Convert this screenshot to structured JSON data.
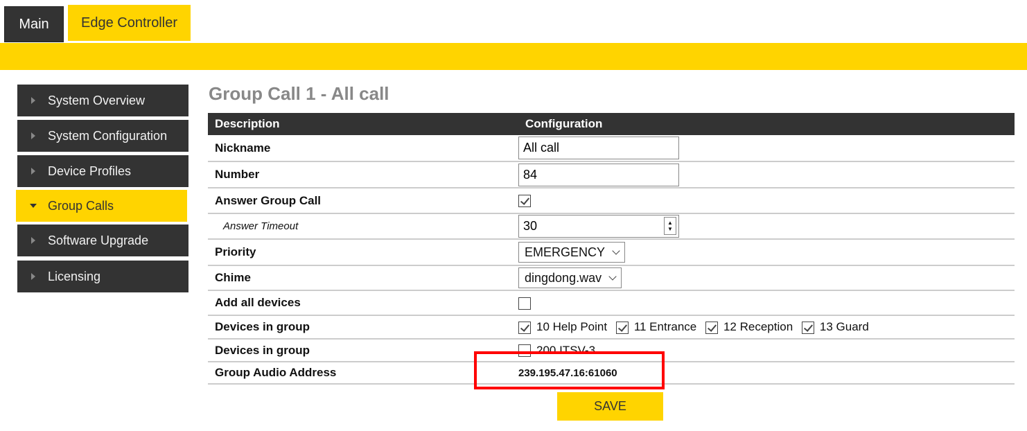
{
  "tabs": {
    "main": "Main",
    "edge": "Edge Controller"
  },
  "sidebar": [
    "System Overview",
    "System Configuration",
    "Device Profiles",
    "Group Calls",
    "Software Upgrade",
    "Licensing"
  ],
  "title": "Group Call 1 - All call",
  "table": {
    "col1": "Description",
    "col2": "Configuration",
    "nickname_label": "Nickname",
    "nickname": "All call",
    "number_label": "Number",
    "number": "84",
    "answer_label": "Answer Group Call",
    "timeout_label": "Answer Timeout",
    "timeout": "30",
    "priority_label": "Priority",
    "priority": "EMERGENCY",
    "chime_label": "Chime",
    "chime": "dingdong.wav",
    "addall_label": "Add all devices",
    "devices_label": "Devices in group",
    "devices": [
      "10 Help Point",
      "11 Entrance",
      "12 Reception",
      "13 Guard"
    ],
    "devices2_label": "Devices in group",
    "devices2": [
      "200 ITSV-3"
    ],
    "audio_label": "Group Audio Address",
    "audio": "239.195.47.16:61060"
  },
  "save": "SAVE"
}
